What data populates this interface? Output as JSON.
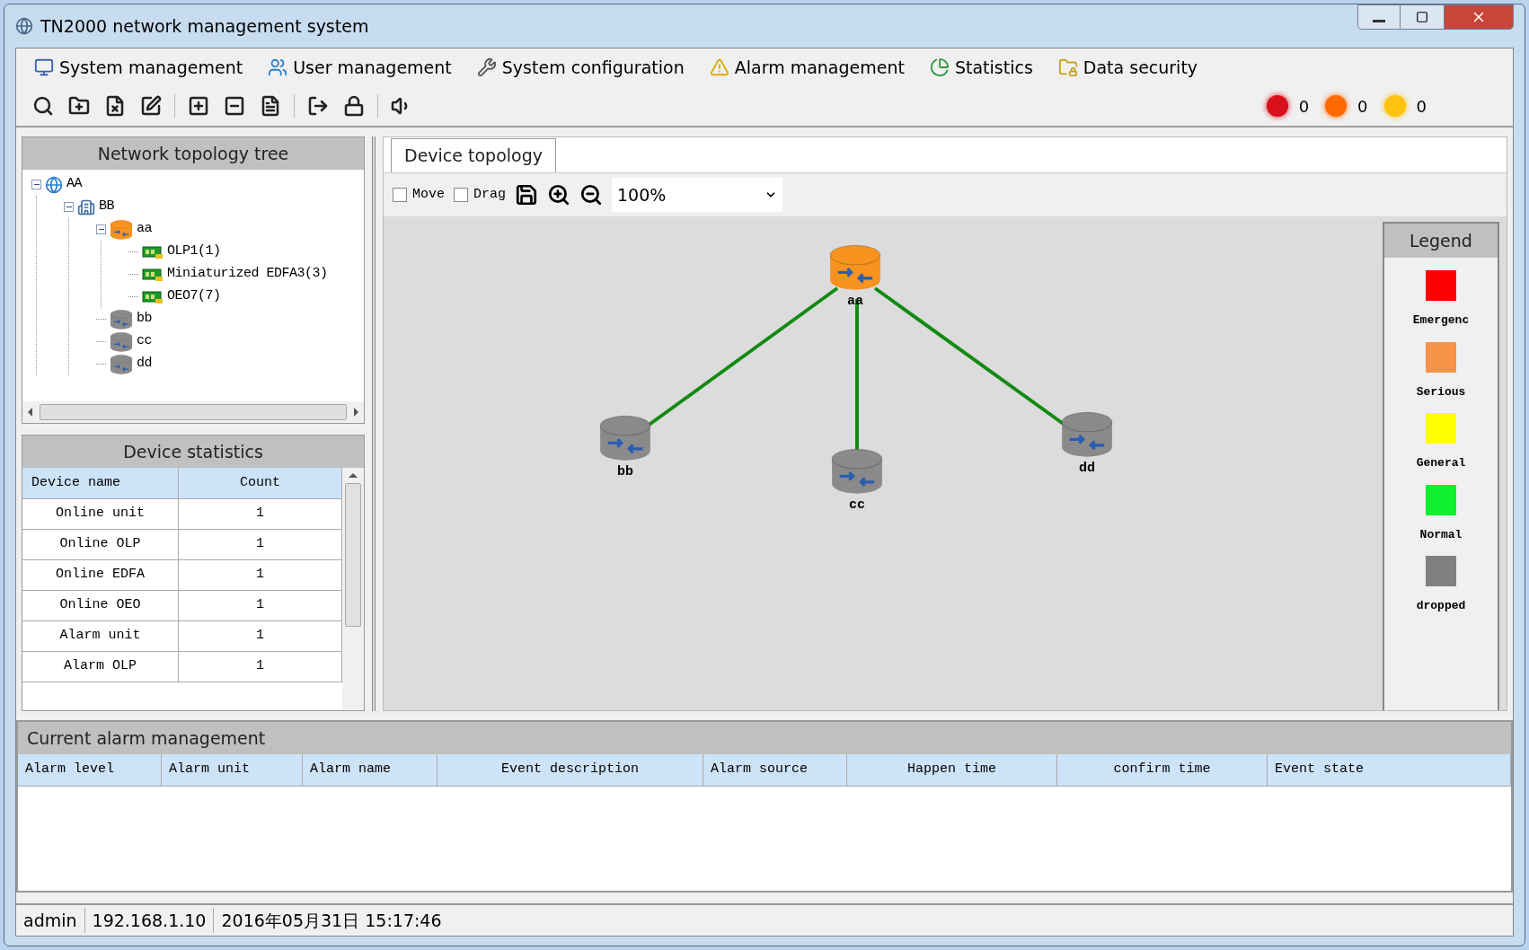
{
  "window": {
    "title": "TN2000 network management system"
  },
  "menu": [
    {
      "label": "System management"
    },
    {
      "label": "User management"
    },
    {
      "label": "System configuration"
    },
    {
      "label": "Alarm management"
    },
    {
      "label": "Statistics"
    },
    {
      "label": "Data security"
    }
  ],
  "alarm_counters": [
    {
      "color": "#d8101c",
      "count": "0"
    },
    {
      "color": "#ff6a00",
      "count": "0"
    },
    {
      "color": "#ffc20e",
      "count": "0"
    }
  ],
  "topology_tree": {
    "title": "Network topology tree",
    "items": [
      {
        "kind": "network",
        "label": "AA",
        "expanded": true,
        "children": [
          {
            "kind": "site",
            "label": "BB",
            "expanded": true,
            "children": [
              {
                "kind": "device",
                "label": "aa",
                "color": "#f7931e",
                "expanded": true,
                "children": [
                  {
                    "kind": "board",
                    "label": "OLP1(1)"
                  },
                  {
                    "kind": "board",
                    "label": "Miniaturized EDFA3(3)"
                  },
                  {
                    "kind": "board",
                    "label": "OEO7(7)"
                  }
                ]
              },
              {
                "kind": "device",
                "label": "bb",
                "color": "#8a8a8a"
              },
              {
                "kind": "device",
                "label": "cc",
                "color": "#8a8a8a"
              },
              {
                "kind": "device",
                "label": "dd",
                "color": "#8a8a8a"
              }
            ]
          }
        ]
      }
    ]
  },
  "device_statistics": {
    "title": "Device statistics",
    "columns": [
      "Device name",
      "Count"
    ],
    "rows": [
      [
        "Online unit",
        "1"
      ],
      [
        "Online OLP",
        "1"
      ],
      [
        "Online EDFA",
        "1"
      ],
      [
        "Online OEO",
        "1"
      ],
      [
        "Alarm unit",
        "1"
      ],
      [
        "Alarm OLP",
        "1"
      ]
    ]
  },
  "tabs": [
    {
      "label": "Device topology",
      "selected": true
    }
  ],
  "topology_toolbar": {
    "move": {
      "label": "Move",
      "checked": false
    },
    "drag": {
      "label": "Drag",
      "checked": false
    },
    "zoom": "100%"
  },
  "topology": {
    "nodes": [
      {
        "label": "aa",
        "color": "#f7931e"
      },
      {
        "label": "bb",
        "color": "#8a8a8a"
      },
      {
        "label": "cc",
        "color": "#8a8a8a"
      },
      {
        "label": "dd",
        "color": "#8a8a8a"
      }
    ]
  },
  "legend": {
    "title": "Legend",
    "items": [
      {
        "label": "Emergenc",
        "color": "#ff0000"
      },
      {
        "label": "Serious",
        "color": "#f7944a"
      },
      {
        "label": "General",
        "color": "#ffff00"
      },
      {
        "label": "Normal",
        "color": "#10ef2e"
      },
      {
        "label": "dropped",
        "color": "#808080"
      }
    ]
  },
  "alarms": {
    "title": "Current alarm management",
    "columns": [
      "Alarm level",
      "Alarm unit",
      "Alarm name",
      "Event description",
      "Alarm source",
      "Happen time",
      "confirm time",
      "Event state"
    ]
  },
  "status_bar": [
    "admin",
    "192.168.1.10",
    "2016年05月31日 15:17:46"
  ]
}
